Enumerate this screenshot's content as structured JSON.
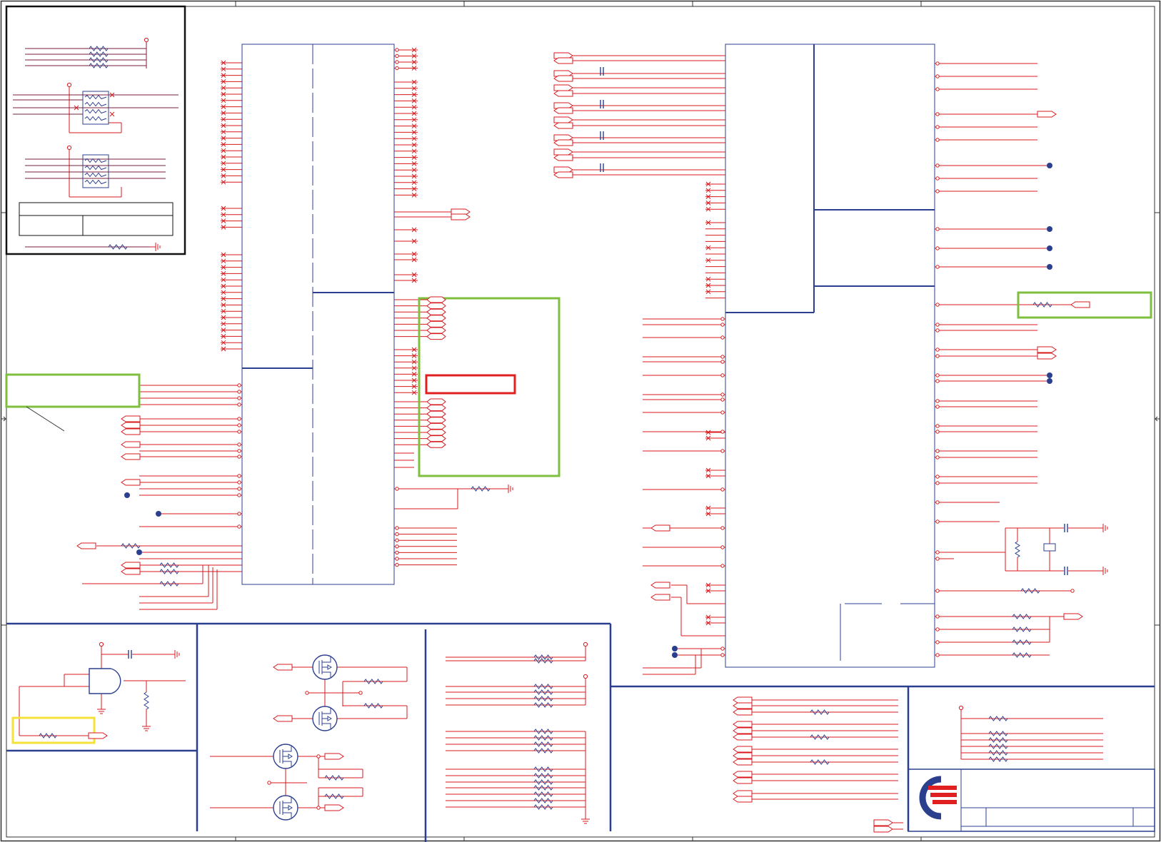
{
  "colors": {
    "wire": "#d8191c",
    "bus": "#2b3f8f",
    "net": "#7a1e3c",
    "note_green": "#7fbf3f",
    "note_red": "#e02020",
    "note_yellow": "#f4e23a",
    "logo_blue": "#2b3f8f",
    "logo_red": "#e02020"
  },
  "title_block": {
    "logo": "company-logo",
    "rev": ""
  },
  "notes": {
    "green_box_count": 3,
    "red_box_count": 1,
    "yellow_box_count": 1
  }
}
